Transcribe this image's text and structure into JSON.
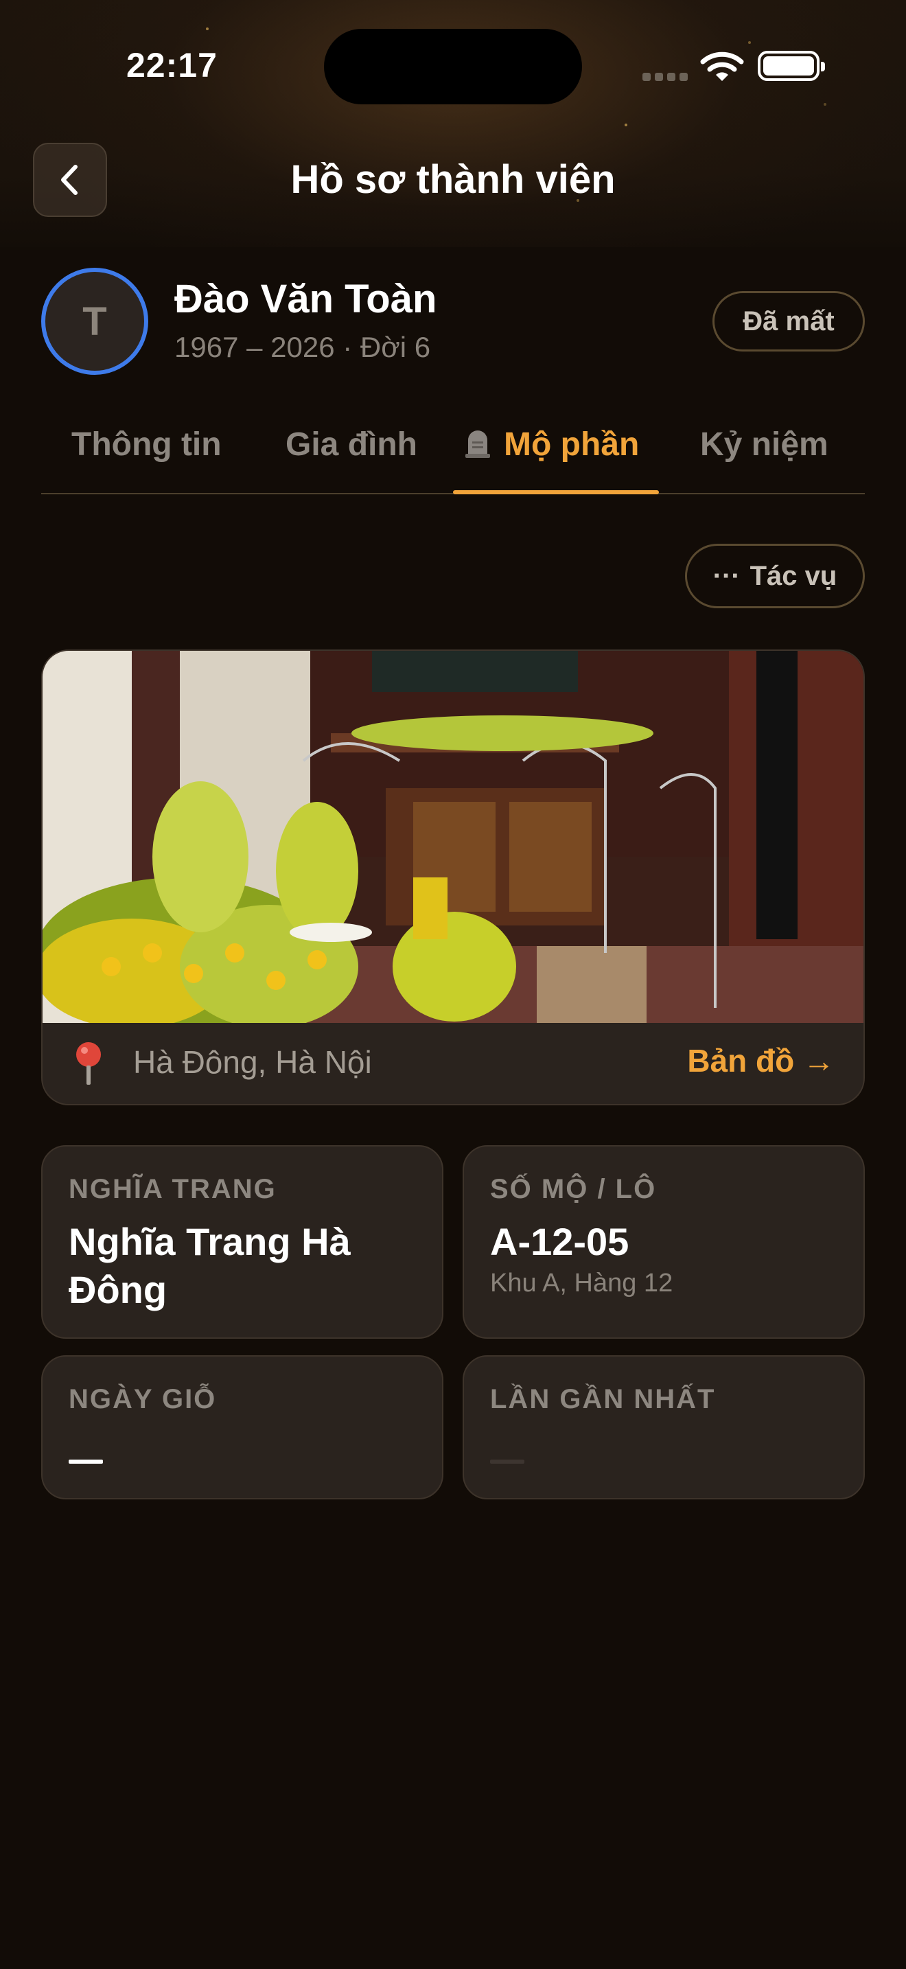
{
  "status_bar": {
    "time": "22:17"
  },
  "nav": {
    "title": "Hồ sơ thành viên",
    "back_icon": "chevron-left-icon"
  },
  "profile": {
    "avatar_letter": "T",
    "name": "Đào Văn Toàn",
    "subtitle": "1967 – 2026 · Đời 6",
    "status": "Đã mất"
  },
  "tabs": [
    {
      "label": "Thông tin",
      "active": false
    },
    {
      "label": "Gia đình",
      "active": false
    },
    {
      "label": "Mộ phần",
      "active": true,
      "icon": "tombstone-icon"
    },
    {
      "label": "Kỷ niệm",
      "active": false
    }
  ],
  "actions": {
    "icon": "···",
    "label": "Tác vụ"
  },
  "grave": {
    "location": "Hà Đông, Hà Nội",
    "map_link": "Bản đồ →"
  },
  "cards": {
    "cemetery": {
      "label": "NGHĨA TRANG",
      "value": "Nghĩa Trang Hà Đông"
    },
    "plot": {
      "label": "SỐ MỘ / LÔ",
      "value": "A-12-05",
      "sub": "Khu A, Hàng 12"
    },
    "anniversary": {
      "label": "NGÀY GIỖ",
      "value": "—"
    },
    "last_visit": {
      "label": "LẦN GẦN NHẤT",
      "value": "—"
    }
  },
  "colors": {
    "accent": "#f1a43a",
    "avatar_ring": "#3e7bea",
    "background": "#120c07",
    "card": "#2a231e"
  }
}
